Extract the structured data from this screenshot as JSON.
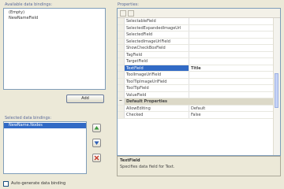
{
  "left": {
    "available_label": "Available data bindings:",
    "available_items": [
      "(Empty)",
      "NewNameField"
    ],
    "add_label": "Add",
    "selected_label": "Selected data bindings:",
    "selected_items": [
      "NewName.Nodes"
    ],
    "auto_generate_label": "Auto-generate data binding"
  },
  "right": {
    "properties_label": "Properties:",
    "rows": [
      {
        "name": "SelectableField",
        "value": "",
        "kind": "prop"
      },
      {
        "name": "SelectedExpandedImageUrl",
        "value": "",
        "kind": "prop"
      },
      {
        "name": "SelectedField",
        "value": "",
        "kind": "prop"
      },
      {
        "name": "SelectedImageUrlField",
        "value": "",
        "kind": "prop"
      },
      {
        "name": "ShowCheckBoxField",
        "value": "",
        "kind": "prop"
      },
      {
        "name": "TagField",
        "value": "",
        "kind": "prop"
      },
      {
        "name": "TargetField",
        "value": "",
        "kind": "prop"
      },
      {
        "name": "TextField",
        "value": "Title",
        "kind": "sel"
      },
      {
        "name": "ToolImageUrlField",
        "value": "",
        "kind": "prop"
      },
      {
        "name": "ToolTipImageUrlField",
        "value": "",
        "kind": "prop"
      },
      {
        "name": "ToolTipField",
        "value": "",
        "kind": "prop"
      },
      {
        "name": "ValueField",
        "value": "",
        "kind": "prop"
      },
      {
        "name": "Default Properties",
        "value": "",
        "kind": "cat"
      },
      {
        "name": "AllowEditing",
        "value": "Default",
        "kind": "prop"
      },
      {
        "name": "Checked",
        "value": "False",
        "kind": "prop"
      }
    ],
    "desc_title": "TextField",
    "desc_text": "Specifies data field for Text."
  },
  "colors": {
    "selection": "#316ac5",
    "label": "#5a6a9a",
    "window": "#ece9d8"
  }
}
